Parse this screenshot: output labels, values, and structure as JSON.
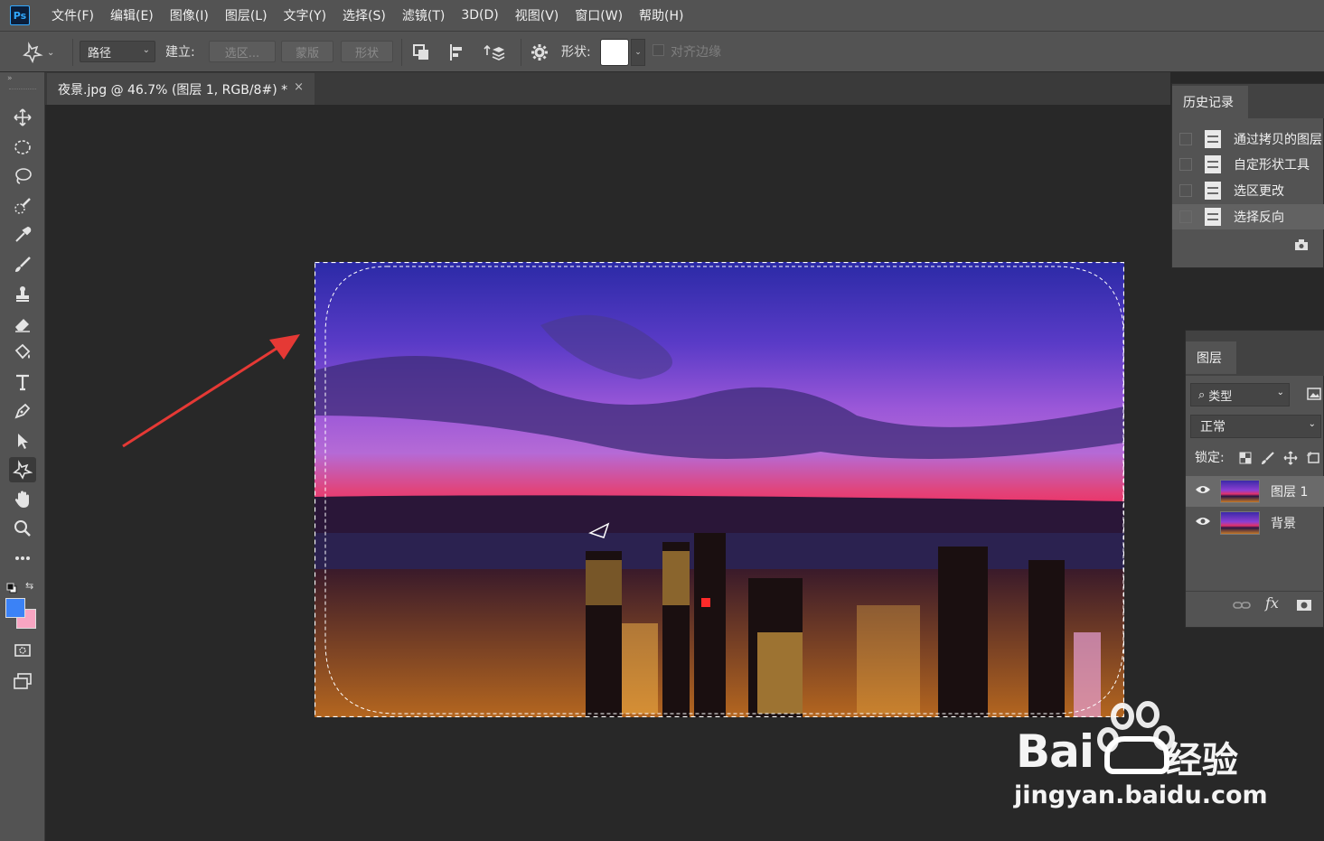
{
  "menubar": {
    "logo": "Ps",
    "items": [
      "文件(F)",
      "编辑(E)",
      "图像(I)",
      "图层(L)",
      "文字(Y)",
      "选择(S)",
      "滤镜(T)",
      "3D(D)",
      "视图(V)",
      "窗口(W)",
      "帮助(H)"
    ]
  },
  "options": {
    "tool_icon": "custom-shape-icon",
    "mode_select": "路径",
    "make_label": "建立:",
    "btn_selection": "选区...",
    "btn_mask": "蒙版",
    "btn_shape": "形状",
    "shape_label": "形状:",
    "align_edges": "对齐边缘"
  },
  "document": {
    "tab_title": "夜景.jpg @ 46.7% (图层 1, RGB/8#) *",
    "close": "×"
  },
  "history": {
    "title": "历史记录",
    "items": [
      "通过拷贝的图层",
      "自定形状工具",
      "选区更改",
      "选择反向"
    ]
  },
  "layers": {
    "title": "图层",
    "filter_label": "类型",
    "blend_mode": "正常",
    "lock_label": "锁定:",
    "items": [
      "图层 1",
      "背景"
    ]
  },
  "watermark": {
    "brand": "Bai",
    "brand2": "经验",
    "url": "jingyan.baidu.com"
  },
  "colors": {
    "foreground": "#3b82f6",
    "background": "#f8a5c2",
    "annotation_arrow": "#e53935"
  }
}
